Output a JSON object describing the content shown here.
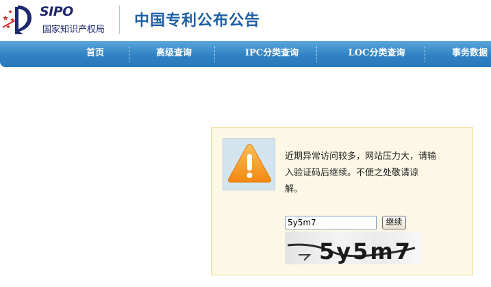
{
  "logo": {
    "en": "SIPO",
    "cn": "国家知识产权局"
  },
  "site_title": "中国专利公布公告",
  "nav": {
    "items": [
      "首页",
      "高级查询",
      "IPC分类查询",
      "LOC分类查询",
      "事务数据"
    ]
  },
  "alert": {
    "icon": "warning-icon",
    "lines": [
      "近期异常访问较多，网站压力大，请输",
      "入验证码后继续。不便之处敬请谅",
      "解。"
    ],
    "captcha_value": "5y5m7",
    "continue_label": "继续",
    "captcha_text": "5y5m7"
  },
  "colors": {
    "nav": "#2f82c4",
    "title": "#1d5fa5",
    "alert_bg": "#fdf8e6",
    "alert_border": "#f1d58a",
    "warning": "#f39a1e"
  }
}
